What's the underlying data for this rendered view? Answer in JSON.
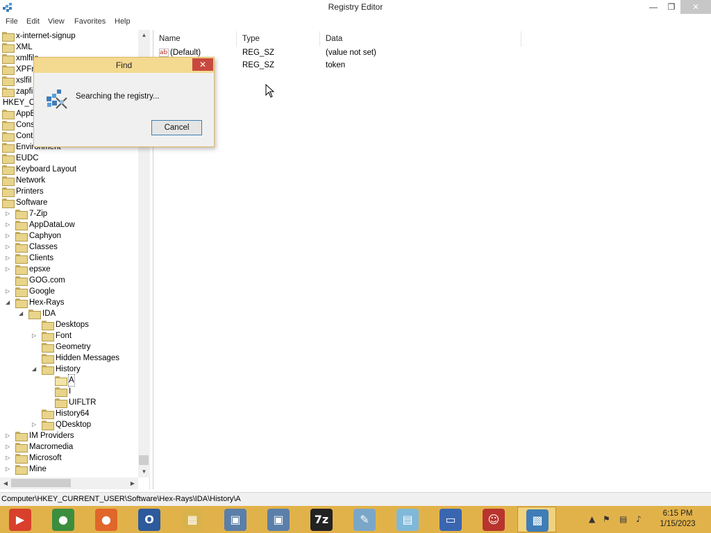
{
  "window": {
    "title": "Registry Editor",
    "minimize_label": "—",
    "maximize_label": "❐",
    "close_label": "✕"
  },
  "menu": [
    "File",
    "Edit",
    "View",
    "Favorites",
    "Help"
  ],
  "tree": [
    {
      "label": "x-internet-signup",
      "level": 0,
      "expander": ""
    },
    {
      "label": "XML",
      "level": 0,
      "expander": ""
    },
    {
      "label": "xmlfile",
      "level": 0,
      "expander": ""
    },
    {
      "label": "XPFra",
      "level": 0,
      "expander": ""
    },
    {
      "label": "xslfil",
      "level": 0,
      "expander": ""
    },
    {
      "label": "zapfi",
      "level": 0,
      "expander": ""
    },
    {
      "label": "HKEY_CU",
      "level": -1,
      "expander": ""
    },
    {
      "label": "AppE",
      "level": 0,
      "expander": ""
    },
    {
      "label": "Cons",
      "level": 0,
      "expander": ""
    },
    {
      "label": "Cont",
      "level": 0,
      "expander": ""
    },
    {
      "label": "Environment",
      "level": 0,
      "expander": ""
    },
    {
      "label": "EUDC",
      "level": 0,
      "expander": ""
    },
    {
      "label": "Keyboard Layout",
      "level": 0,
      "expander": ""
    },
    {
      "label": "Network",
      "level": 0,
      "expander": ""
    },
    {
      "label": "Printers",
      "level": 0,
      "expander": ""
    },
    {
      "label": "Software",
      "level": 0,
      "expander": ""
    },
    {
      "label": "7-Zip",
      "level": 1,
      "expander": "▷"
    },
    {
      "label": "AppDataLow",
      "level": 1,
      "expander": "▷"
    },
    {
      "label": "Caphyon",
      "level": 1,
      "expander": "▷"
    },
    {
      "label": "Classes",
      "level": 1,
      "expander": "▷"
    },
    {
      "label": "Clients",
      "level": 1,
      "expander": "▷"
    },
    {
      "label": "epsxe",
      "level": 1,
      "expander": "▷"
    },
    {
      "label": "GOG.com",
      "level": 1,
      "expander": ""
    },
    {
      "label": "Google",
      "level": 1,
      "expander": "▷"
    },
    {
      "label": "Hex-Rays",
      "level": 1,
      "expander": "◢"
    },
    {
      "label": "IDA",
      "level": 2,
      "expander": "◢"
    },
    {
      "label": "Desktops",
      "level": 3,
      "expander": ""
    },
    {
      "label": "Font",
      "level": 3,
      "expander": "▷"
    },
    {
      "label": "Geometry",
      "level": 3,
      "expander": ""
    },
    {
      "label": "Hidden Messages",
      "level": 3,
      "expander": ""
    },
    {
      "label": "History",
      "level": 3,
      "expander": "◢"
    },
    {
      "label": "A",
      "level": 4,
      "expander": "",
      "selected": true
    },
    {
      "label": "I",
      "level": 4,
      "expander": ""
    },
    {
      "label": "UIFLTR",
      "level": 4,
      "expander": ""
    },
    {
      "label": "History64",
      "level": 3,
      "expander": ""
    },
    {
      "label": "QDesktop",
      "level": 3,
      "expander": "▷"
    },
    {
      "label": "IM Providers",
      "level": 1,
      "expander": "▷"
    },
    {
      "label": "Macromedia",
      "level": 1,
      "expander": "▷"
    },
    {
      "label": "Microsoft",
      "level": 1,
      "expander": "▷"
    },
    {
      "label": "Mine",
      "level": 1,
      "expander": "▷"
    }
  ],
  "values_header": {
    "name": "Name",
    "type": "Type",
    "data": "Data"
  },
  "values": [
    {
      "name": "(Default)",
      "type": "REG_SZ",
      "data": "(value not set)"
    },
    {
      "name": "",
      "type": "REG_SZ",
      "data": "token"
    }
  ],
  "status": {
    "path": "Computer\\HKEY_CURRENT_USER\\Software\\Hex-Rays\\IDA\\History\\A"
  },
  "find_dialog": {
    "title": "Find",
    "message": "Searching the registry...",
    "cancel_label": "Cancel",
    "close_label": "✕"
  },
  "taskbar": {
    "apps": [
      {
        "name": "media-player",
        "color": "#d8402c",
        "glyph": "▶"
      },
      {
        "name": "chrome",
        "color": "#3b8e3e",
        "glyph": "●"
      },
      {
        "name": "firefox",
        "color": "#e0662a",
        "glyph": "●"
      },
      {
        "name": "origin",
        "color": "#2d5a9c",
        "glyph": "O"
      },
      {
        "name": "file-explorer",
        "color": "#d9b24c",
        "glyph": "▦"
      },
      {
        "name": "network-tool",
        "color": "#5a7fa8",
        "glyph": "▣"
      },
      {
        "name": "network-tool-2",
        "color": "#5a7fa8",
        "glyph": "▣"
      },
      {
        "name": "7zip",
        "color": "#222222",
        "glyph": "7z"
      },
      {
        "name": "paint",
        "color": "#7aa7c8",
        "glyph": "✎"
      },
      {
        "name": "notepad",
        "color": "#7fb8d8",
        "glyph": "▤"
      },
      {
        "name": "remote-desktop",
        "color": "#3a66b0",
        "glyph": "▭"
      },
      {
        "name": "game",
        "color": "#b8342d",
        "glyph": "☺"
      },
      {
        "name": "registry-editor",
        "color": "#3f7db8",
        "glyph": "▩",
        "active": true
      }
    ],
    "tray": {
      "time": "6:15 PM",
      "date": "1/15/2023"
    }
  }
}
